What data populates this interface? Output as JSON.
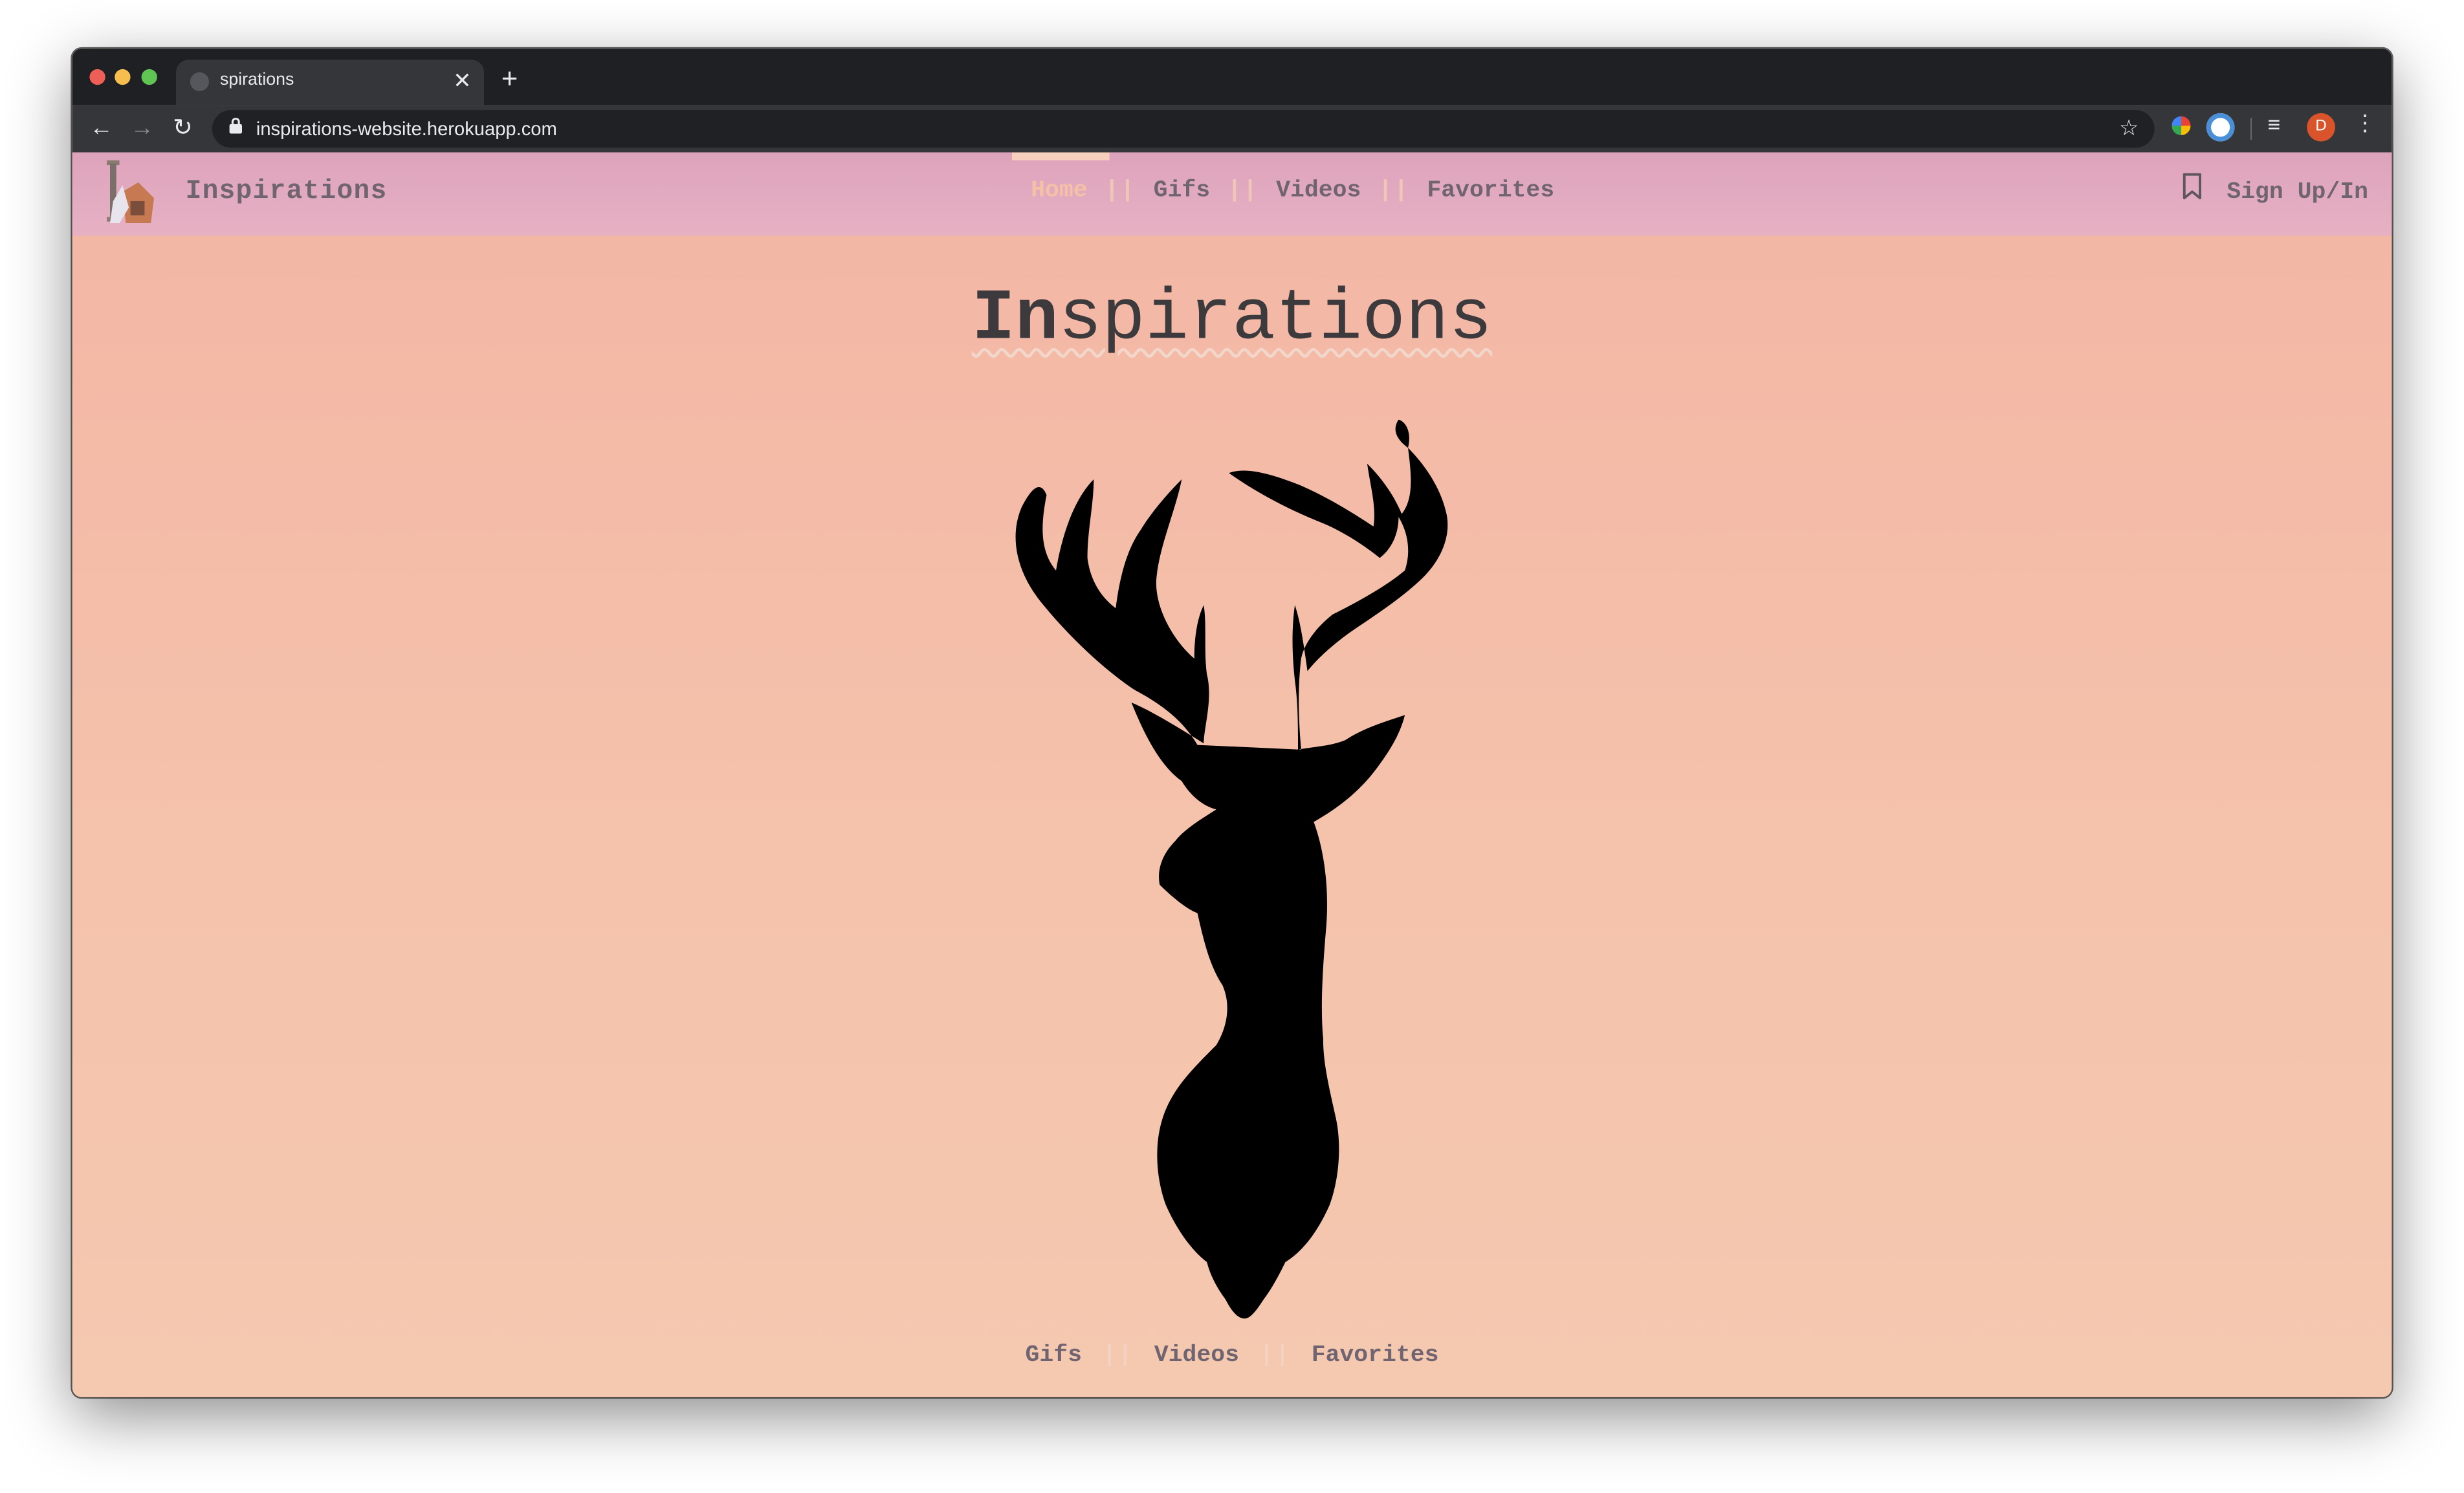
{
  "browser": {
    "tab_title": "spirations",
    "tab_close": "✕",
    "new_tab": "+",
    "url": "inspirations-website.herokuapp.com",
    "back": "←",
    "forward": "→",
    "reload": "↻",
    "lock": "🔒",
    "star": "☆",
    "queue": "≡",
    "avatar_initial": "D",
    "menu": "⋮"
  },
  "navbar": {
    "brand": "Inspirations",
    "items": [
      {
        "label": "Home",
        "active": true
      },
      {
        "label": "Gifs",
        "active": false
      },
      {
        "label": "Videos",
        "active": false
      },
      {
        "label": "Favorites",
        "active": false
      }
    ],
    "separator": "||",
    "sign_in": "Sign Up/In"
  },
  "hero": {
    "title_bold": "In",
    "title_rest": "spirations"
  },
  "footer": {
    "items": [
      {
        "label": "Gifs"
      },
      {
        "label": "Videos"
      },
      {
        "label": "Favorites"
      }
    ],
    "separator": "||"
  },
  "colors": {
    "page_bg": "#f4bfa8",
    "navbar_bg": "#e2a9c0",
    "nav_text": "#6f6470",
    "active_text": "#f4c0a6",
    "title_text": "#3d3a3d"
  }
}
